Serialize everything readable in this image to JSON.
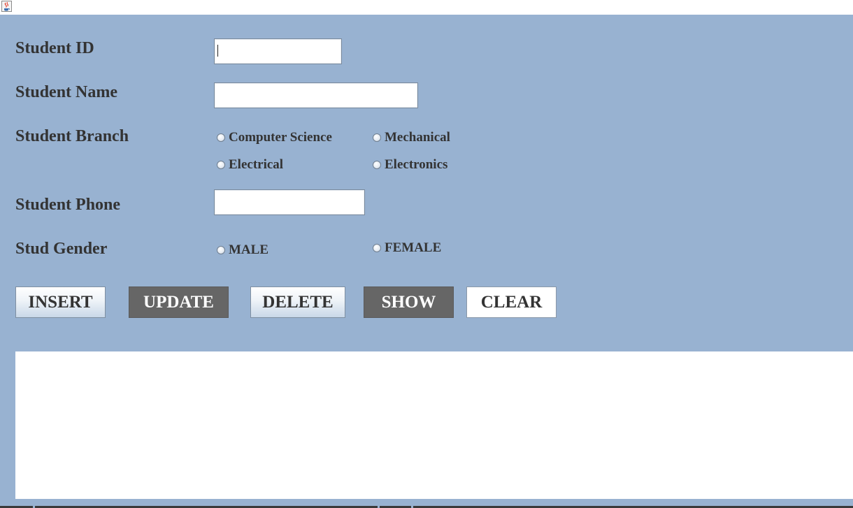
{
  "window": {
    "icon": "java-cup-icon"
  },
  "form": {
    "student_id": {
      "label": "Student ID",
      "value": ""
    },
    "student_name": {
      "label": "Student Name",
      "value": ""
    },
    "student_branch": {
      "label": "Student Branch",
      "options": [
        "Computer Science",
        "Mechanical",
        "Electrical",
        "Electronics"
      ]
    },
    "student_phone": {
      "label": "Student Phone",
      "value": ""
    },
    "stud_gender": {
      "label": "Stud Gender",
      "options": [
        "MALE",
        "FEMALE"
      ]
    }
  },
  "buttons": {
    "insert": "INSERT",
    "update": "UPDATE",
    "delete": "DELETE",
    "show": "SHOW",
    "clear": "CLEAR"
  },
  "colors": {
    "panel_background": "#98b2d1",
    "dark_button": "#666666"
  }
}
